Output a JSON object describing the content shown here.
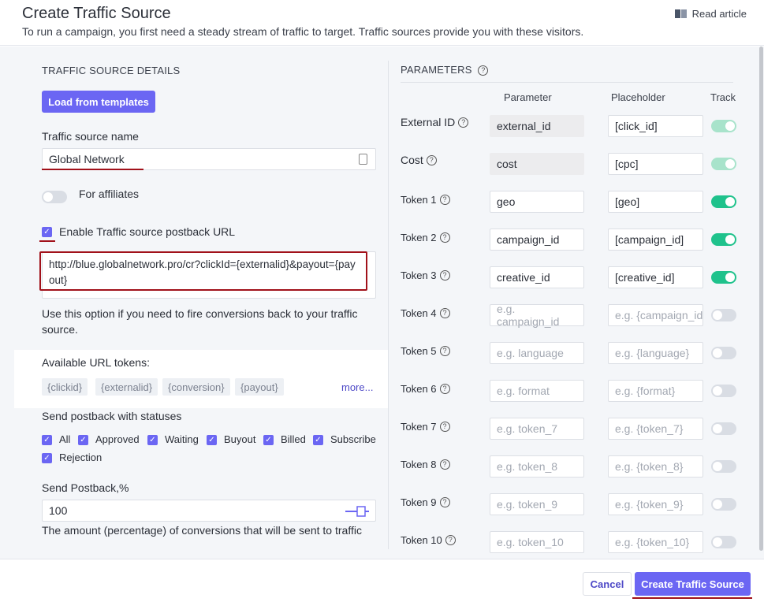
{
  "header": {
    "title": "Create Traffic Source",
    "subtitle": "To run a campaign, you first need a steady stream of traffic to target. Traffic sources provide you with these visitors.",
    "read_article": "Read article"
  },
  "left": {
    "section_title": "TRAFFIC SOURCE DETAILS",
    "load_templates": "Load from templates",
    "name_label": "Traffic source name",
    "name_value": "Global Network",
    "affiliates_label": "For affiliates",
    "postback_label": "Enable Traffic source postback URL",
    "postback_url": "http://blue.globalnetwork.pro/cr?clickId={externalid}&payout={payout}",
    "postback_help": "Use this option if you need to fire conversions back to your traffic source.",
    "tokens_label": "Available URL tokens:",
    "tokens": [
      "{clickid}",
      "{externalid}",
      "{conversion}",
      "{payout}"
    ],
    "more": "more...",
    "statuses_label": "Send postback with statuses",
    "statuses": [
      "All",
      "Approved",
      "Waiting",
      "Buyout",
      "Billed",
      "Subscribe",
      "Rejection"
    ],
    "send_postback_label": "Send Postback,%",
    "send_postback_value": "100",
    "send_postback_help": "The amount (percentage) of conversions that will be sent to traffic"
  },
  "right": {
    "section_title": "PARAMETERS",
    "col_parameter": "Parameter",
    "col_placeholder": "Placeholder",
    "col_track": "Track",
    "rows": [
      {
        "label": "External ID",
        "parameter": "external_id",
        "placeholder": "[click_id]",
        "track": true
      },
      {
        "label": "Cost",
        "parameter": "cost",
        "placeholder": "[cpc]",
        "track": true
      },
      {
        "label": "Token 1",
        "parameter": "geo",
        "placeholder": "[geo]",
        "track": true
      },
      {
        "label": "Token 2",
        "parameter": "campaign_id",
        "placeholder": "[campaign_id]",
        "track": true
      },
      {
        "label": "Token 3",
        "parameter": "creative_id",
        "placeholder": "[creative_id]",
        "track": true
      },
      {
        "label": "Token 4",
        "parameter_ph": "e.g. campaign_id",
        "placeholder_ph": "e.g. {campaign_id}",
        "track": false
      },
      {
        "label": "Token 5",
        "parameter_ph": "e.g. language",
        "placeholder_ph": "e.g. {language}",
        "track": false
      },
      {
        "label": "Token 6",
        "parameter_ph": "e.g. format",
        "placeholder_ph": "e.g. {format}",
        "track": false
      },
      {
        "label": "Token 7",
        "parameter_ph": "e.g. token_7",
        "placeholder_ph": "e.g. {token_7}",
        "track": false
      },
      {
        "label": "Token 8",
        "parameter_ph": "e.g. token_8",
        "placeholder_ph": "e.g. {token_8}",
        "track": false
      },
      {
        "label": "Token 9",
        "parameter_ph": "e.g. token_9",
        "placeholder_ph": "e.g. {token_9}",
        "track": false
      },
      {
        "label": "Token 10",
        "parameter_ph": "e.g. token_10",
        "placeholder_ph": "e.g. {token_10}",
        "track": false
      }
    ]
  },
  "footer": {
    "cancel": "Cancel",
    "create": "Create Traffic Source"
  }
}
